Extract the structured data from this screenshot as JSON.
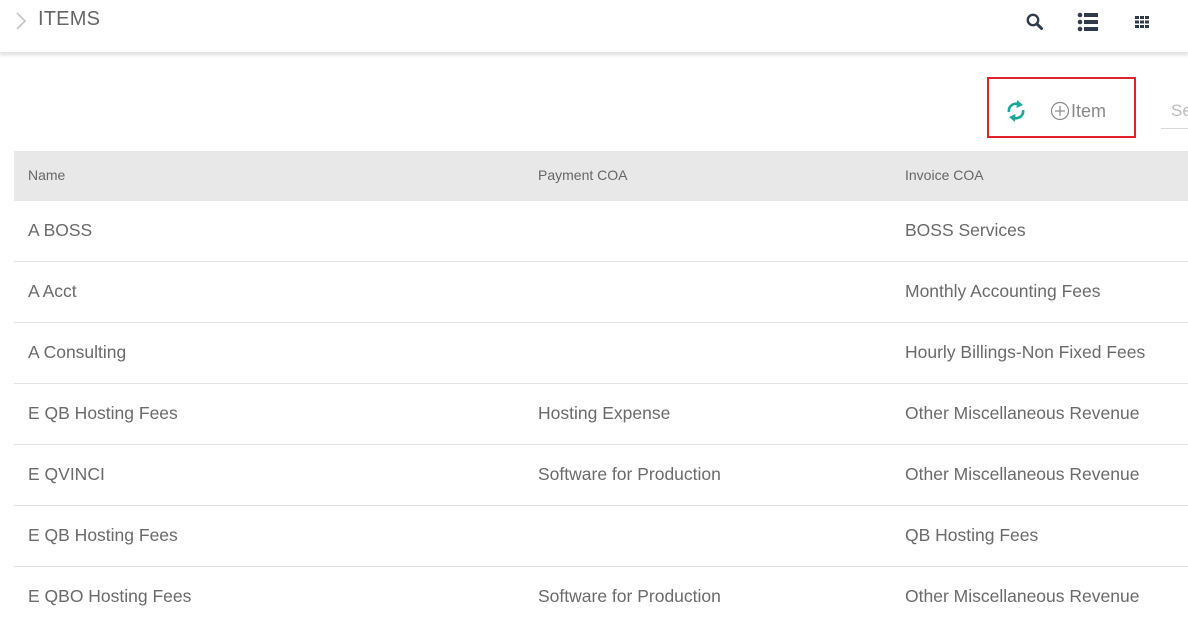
{
  "header": {
    "title": "ITEMS",
    "icons": [
      "chevron-right-icon",
      "search-icon",
      "list-view-icon",
      "grid-view-icon"
    ]
  },
  "toolbar": {
    "add_label": "Item",
    "search_placeholder": "Search",
    "highlight_color": "#e0242a",
    "refresh_color": "#1aa89a"
  },
  "table": {
    "columns": [
      "Name",
      "Payment COA",
      "Invoice COA"
    ],
    "rows": [
      {
        "name": "A BOSS",
        "payment_coa": "",
        "invoice_coa": "BOSS Services"
      },
      {
        "name": "A Acct",
        "payment_coa": "",
        "invoice_coa": "Monthly Accounting Fees"
      },
      {
        "name": "A Consulting",
        "payment_coa": "",
        "invoice_coa": "Hourly Billings-Non Fixed Fees"
      },
      {
        "name": "E QB Hosting Fees",
        "payment_coa": "Hosting Expense",
        "invoice_coa": "Other Miscellaneous Revenue"
      },
      {
        "name": "E QVINCI",
        "payment_coa": "Software for Production",
        "invoice_coa": "Other Miscellaneous Revenue"
      },
      {
        "name": "E QB Hosting Fees",
        "payment_coa": "",
        "invoice_coa": "QB Hosting Fees"
      },
      {
        "name": "E QBO Hosting Fees",
        "payment_coa": "Software for Production",
        "invoice_coa": "Other Miscellaneous Revenue"
      }
    ]
  }
}
